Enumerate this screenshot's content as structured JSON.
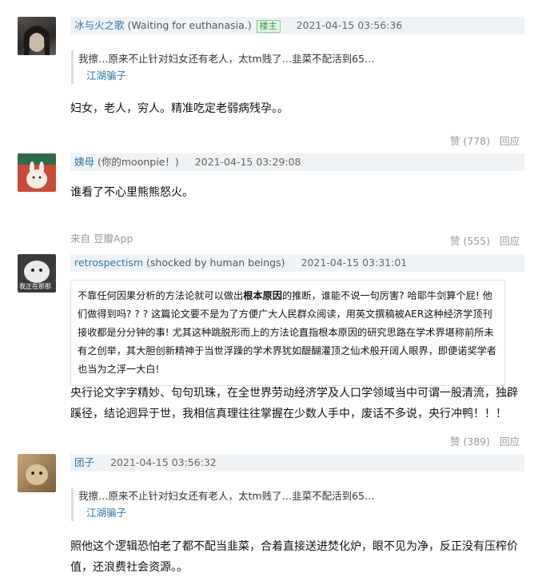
{
  "comments": [
    {
      "author": "冰与火之歌",
      "signature": "(Waiting for euthanasia.)",
      "badge": "楼主",
      "time": "2021-04-15 03:56:36",
      "quote_text": "我擦…原来不止针对妇女还有老人，太tm贱了…韭菜不配活到65…",
      "quote_author": "江湖骗子",
      "text": "妇女，老人，穷人。精准吃定老弱病残孕。。",
      "like_label": "赞 (778)",
      "reply_label": "回应"
    },
    {
      "author": "姨母",
      "signature": "(你的moonpie！)",
      "time": "2021-04-15 03:29:08",
      "text": "谁看了不心里熊熊怒火。",
      "source": "来自 豆瓣App",
      "like_label": "赞 (555)",
      "reply_label": "回应"
    },
    {
      "author": "retrospectism",
      "signature": "(shocked by human beings)",
      "time": "2021-04-15 03:31:01",
      "box_pre": "不靠任何因果分析的方法论就可以做出",
      "box_bold": "根本原因",
      "box_post": "的推断，谁能不说一句厉害? 哈耶牛剑算个屁! 他们做得到吗? ? ? 这篇论文要不是为了方便广大人民群众阅读，用英文撰稿被AER这种经济学顶刊接收都是分分钟的事! 尤其这种跳脱形而上的方法论直指根本原因的研究思路在学术界堪称前所未有之创举，其大胆创新精神于当世浮躁的学术界犹如醍醐灌顶之仙术般开阔人眼界，即便诺奖学者也当为之浮一大白!",
      "text": "央行论文字字精妙、句句玑珠，在全世界劳动经济学及人口学领域当中可谓一股清流，独辟蹊径，结论迥异于世，我相信真理往往掌握在少数人手中，废话不多说，央行冲鸭！！！",
      "like_label": "赞 (389)",
      "reply_label": "回应"
    },
    {
      "author": "团子",
      "time": "2021-04-15 03:56:32",
      "quote_text": "我擦…原来不止针对妇女还有老人，太tm贱了…韭菜不配活到65…",
      "quote_author": "江湖骗子",
      "text": "照他这个逻辑恐怕老了都不配当韭菜，合着直接送进焚化炉，眼不见为净，反正没有压榨价值，还浪费社会资源。。"
    }
  ],
  "avatar3_caption": "我正在那那",
  "colors": {
    "link": "#3377aa",
    "meta_bg": "#f0f3f5",
    "badge_green": "#2e963d",
    "muted": "#999999"
  }
}
